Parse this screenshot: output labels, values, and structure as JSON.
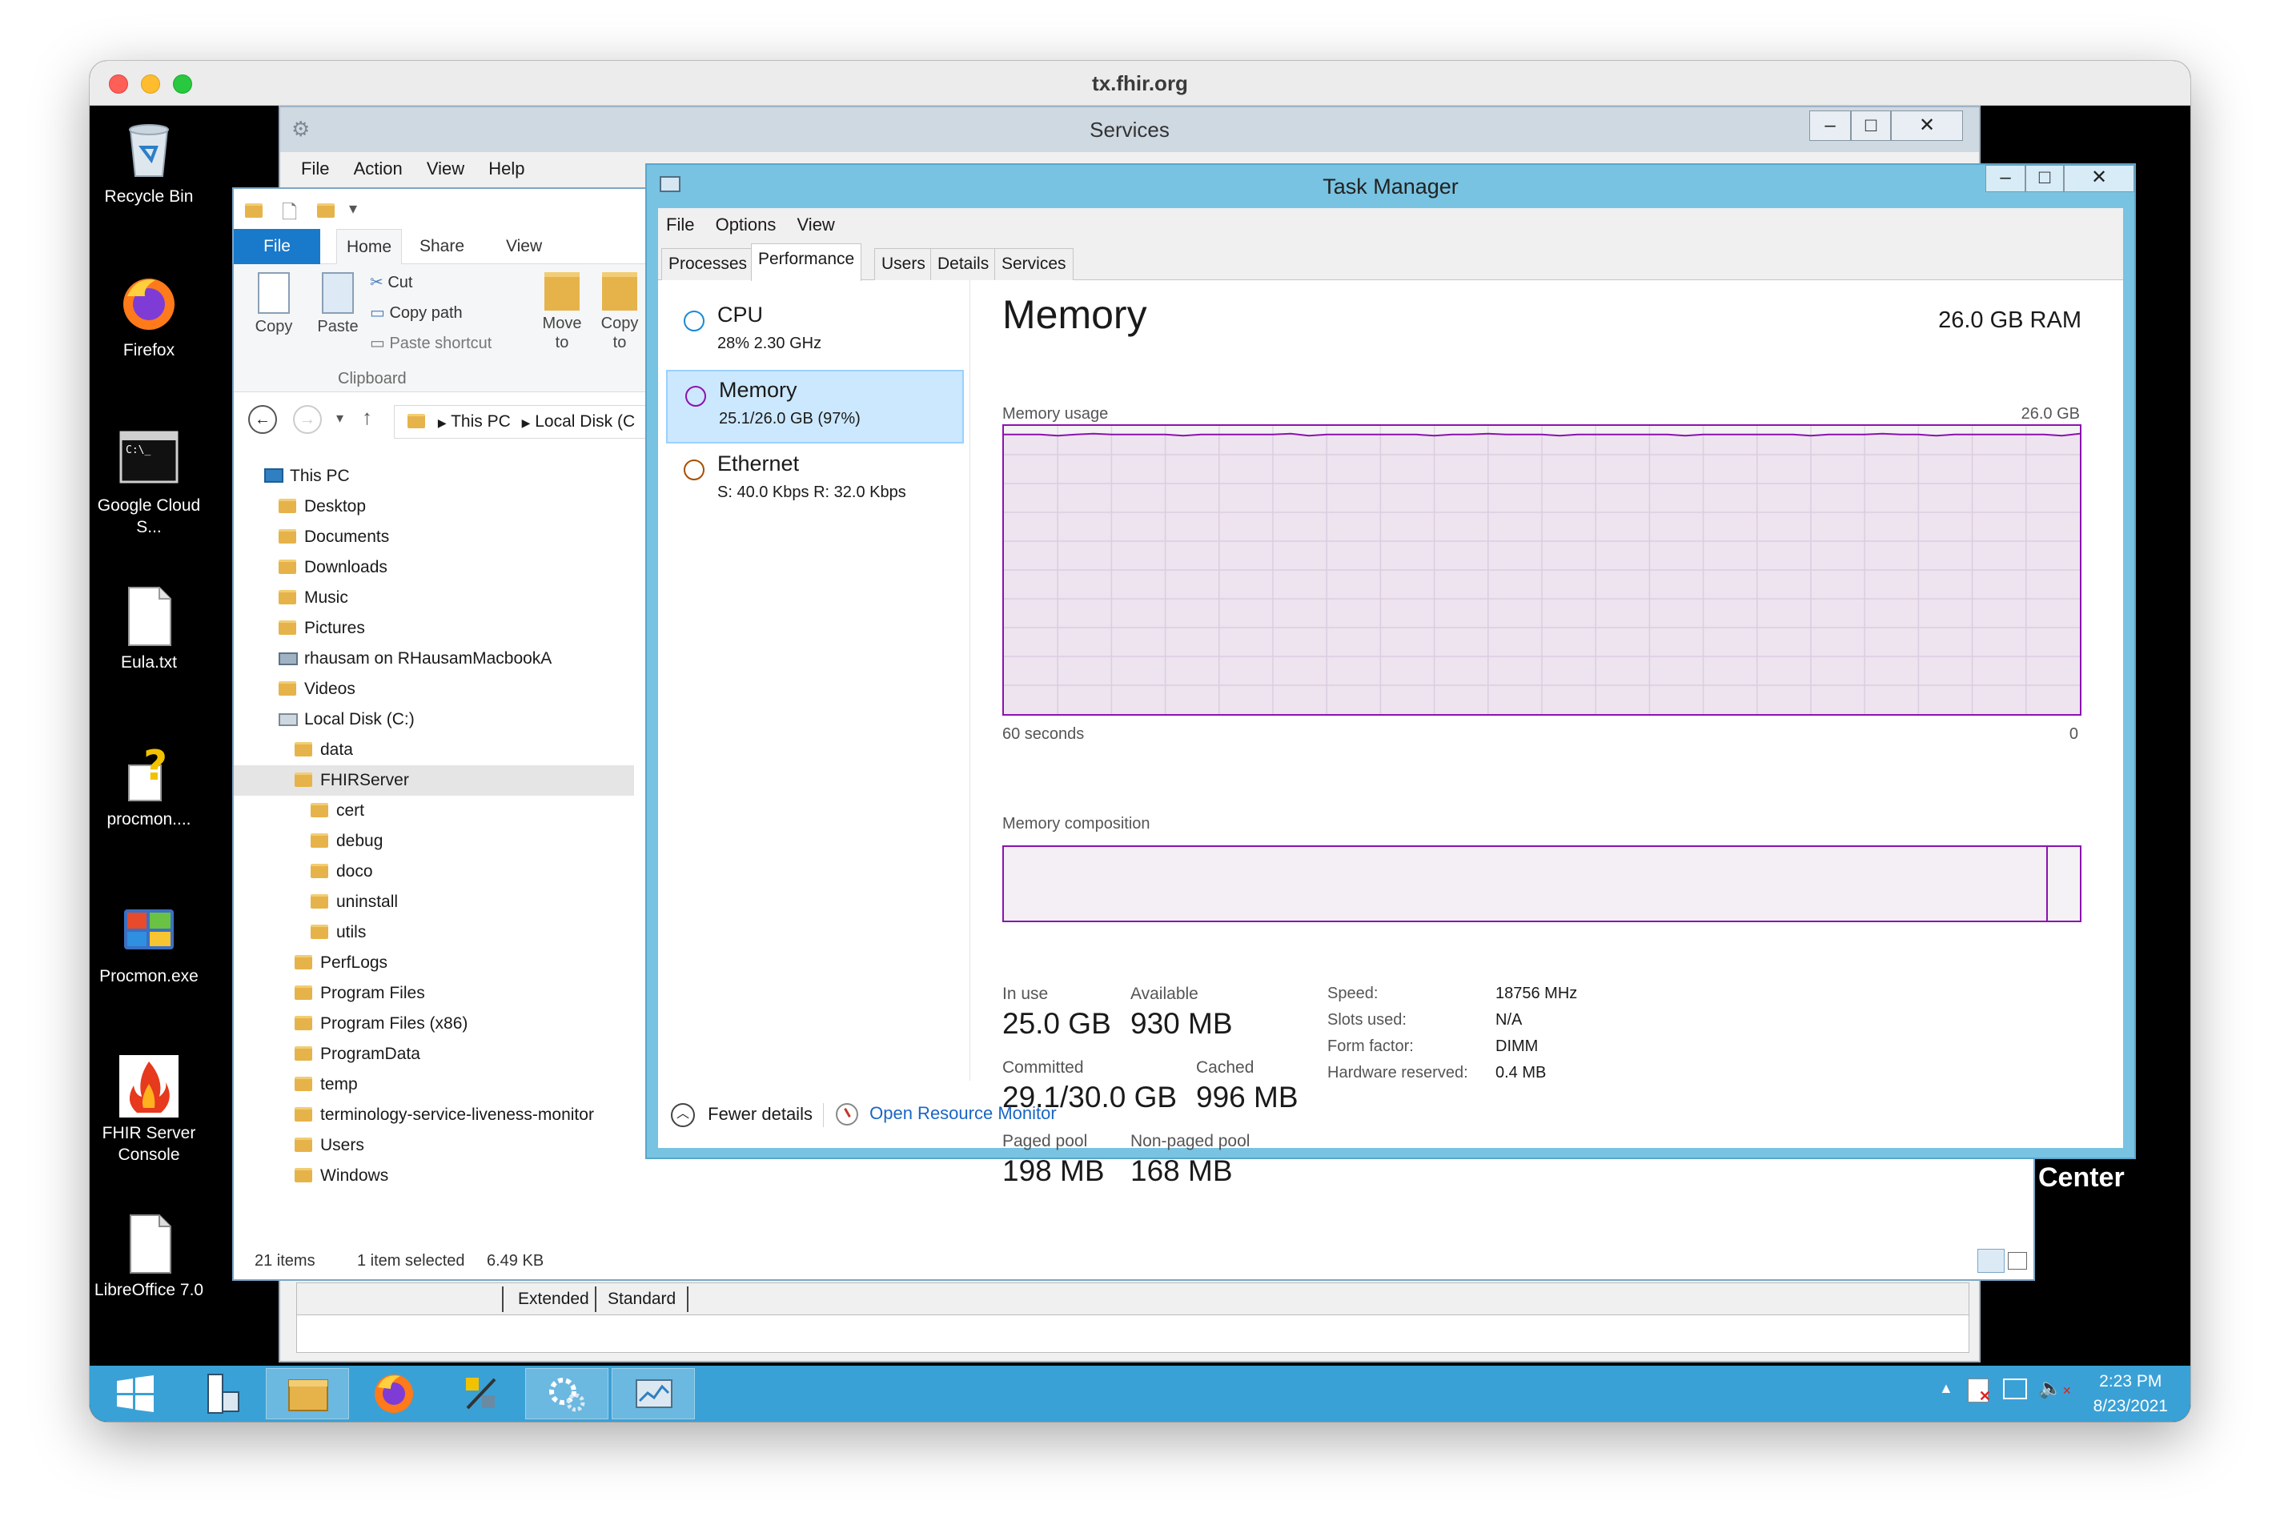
{
  "mac_window": {
    "title": "tx.fhir.org"
  },
  "desktop_icons": [
    {
      "label": "Recycle Bin",
      "icon": "recycle-bin-icon"
    },
    {
      "label": "Firefox",
      "icon": "firefox-icon"
    },
    {
      "label": "Google Cloud S...",
      "icon": "terminal-icon"
    },
    {
      "label": "Eula.txt",
      "icon": "document-icon"
    },
    {
      "label": "procmon....",
      "icon": "help-document-icon"
    },
    {
      "label": "Procmon.exe",
      "icon": "procmon-icon"
    },
    {
      "label": "FHIR Server Console",
      "icon": "fhir-flame-icon"
    },
    {
      "label": "LibreOffice 7.0",
      "icon": "libreoffice-icon"
    }
  ],
  "services_window": {
    "title": "Services",
    "menu": [
      "File",
      "Action",
      "View",
      "Help"
    ],
    "bottom_tabs": [
      "Extended",
      "Standard"
    ],
    "partial_text": "Center"
  },
  "explorer": {
    "ribbon_tabs": [
      "File",
      "Home",
      "Share",
      "View"
    ],
    "clipboard": {
      "copy": "Copy",
      "paste": "Paste",
      "cut": "Cut",
      "copy_path": "Copy path",
      "paste_shortcut": "Paste shortcut",
      "group_label": "Clipboard"
    },
    "organize": {
      "move_to": "Move to",
      "copy_to": "Copy to"
    },
    "address": {
      "this_pc": "This PC",
      "local_disk": "Local Disk (C"
    },
    "tree": [
      {
        "label": "This PC",
        "depth": 0,
        "type": "pc"
      },
      {
        "label": "Desktop",
        "depth": 1,
        "type": "folder"
      },
      {
        "label": "Documents",
        "depth": 1,
        "type": "folder"
      },
      {
        "label": "Downloads",
        "depth": 1,
        "type": "folder"
      },
      {
        "label": "Music",
        "depth": 1,
        "type": "folder"
      },
      {
        "label": "Pictures",
        "depth": 1,
        "type": "folder"
      },
      {
        "label": "rhausam on RHausamMacbookA",
        "depth": 1,
        "type": "network"
      },
      {
        "label": "Videos",
        "depth": 1,
        "type": "folder"
      },
      {
        "label": "Local Disk (C:)",
        "depth": 1,
        "type": "drive"
      },
      {
        "label": "data",
        "depth": 2,
        "type": "folder"
      },
      {
        "label": "FHIRServer",
        "depth": 2,
        "type": "folder",
        "selected": true
      },
      {
        "label": "cert",
        "depth": 3,
        "type": "folder"
      },
      {
        "label": "debug",
        "depth": 3,
        "type": "folder"
      },
      {
        "label": "doco",
        "depth": 3,
        "type": "folder"
      },
      {
        "label": "uninstall",
        "depth": 3,
        "type": "folder"
      },
      {
        "label": "utils",
        "depth": 3,
        "type": "folder"
      },
      {
        "label": "PerfLogs",
        "depth": 2,
        "type": "folder"
      },
      {
        "label": "Program Files",
        "depth": 2,
        "type": "folder"
      },
      {
        "label": "Program Files (x86)",
        "depth": 2,
        "type": "folder"
      },
      {
        "label": "ProgramData",
        "depth": 2,
        "type": "folder"
      },
      {
        "label": "temp",
        "depth": 2,
        "type": "folder"
      },
      {
        "label": "terminology-service-liveness-monitor",
        "depth": 2,
        "type": "folder"
      },
      {
        "label": "Users",
        "depth": 2,
        "type": "folder"
      },
      {
        "label": "Windows",
        "depth": 2,
        "type": "folder"
      }
    ],
    "status": {
      "items": "21 items",
      "selected": "1 item selected",
      "size": "6.49 KB"
    }
  },
  "task_manager": {
    "title": "Task Manager",
    "menu": [
      "File",
      "Options",
      "View"
    ],
    "tabs": [
      "Processes",
      "Performance",
      "Users",
      "Details",
      "Services"
    ],
    "active_tab": "Performance",
    "resources": [
      {
        "name": "CPU",
        "detail": "28%  2.30 GHz",
        "color": "#1a8ad4",
        "selected": false
      },
      {
        "name": "Memory",
        "detail": "25.1/26.0 GB (97%)",
        "color": "#8b12ae",
        "selected": true
      },
      {
        "name": "Ethernet",
        "detail": "S: 40.0 Kbps  R: 32.0 Kbps",
        "color": "#a74f01",
        "selected": false
      }
    ],
    "memory": {
      "title": "Memory",
      "total": "26.0 GB RAM",
      "usage_label": "Memory usage",
      "usage_max": "26.0 GB",
      "time_label": "60 seconds",
      "time_end": "0",
      "composition_label": "Memory composition",
      "usage_fraction": 0.97,
      "stats": {
        "in_use_label": "In use",
        "in_use": "25.0 GB",
        "available_label": "Available",
        "available": "930 MB",
        "committed_label": "Committed",
        "committed": "29.1/30.0 GB",
        "cached_label": "Cached",
        "cached": "996 MB",
        "paged_label": "Paged pool",
        "paged": "198 MB",
        "nonpaged_label": "Non-paged pool",
        "nonpaged": "168 MB"
      },
      "specs": {
        "speed_label": "Speed:",
        "speed": "18756 MHz",
        "slots_label": "Slots used:",
        "slots": "N/A",
        "form_label": "Form factor:",
        "form": "DIMM",
        "hwres_label": "Hardware reserved:",
        "hwres": "0.4 MB"
      }
    },
    "footer": {
      "fewer": "Fewer details",
      "resmon": "Open Resource Monitor"
    },
    "accent": "#8b12ae"
  },
  "taskbar": {
    "time": "2:23 PM",
    "date": "8/23/2021",
    "color": "#3aa1d6"
  }
}
